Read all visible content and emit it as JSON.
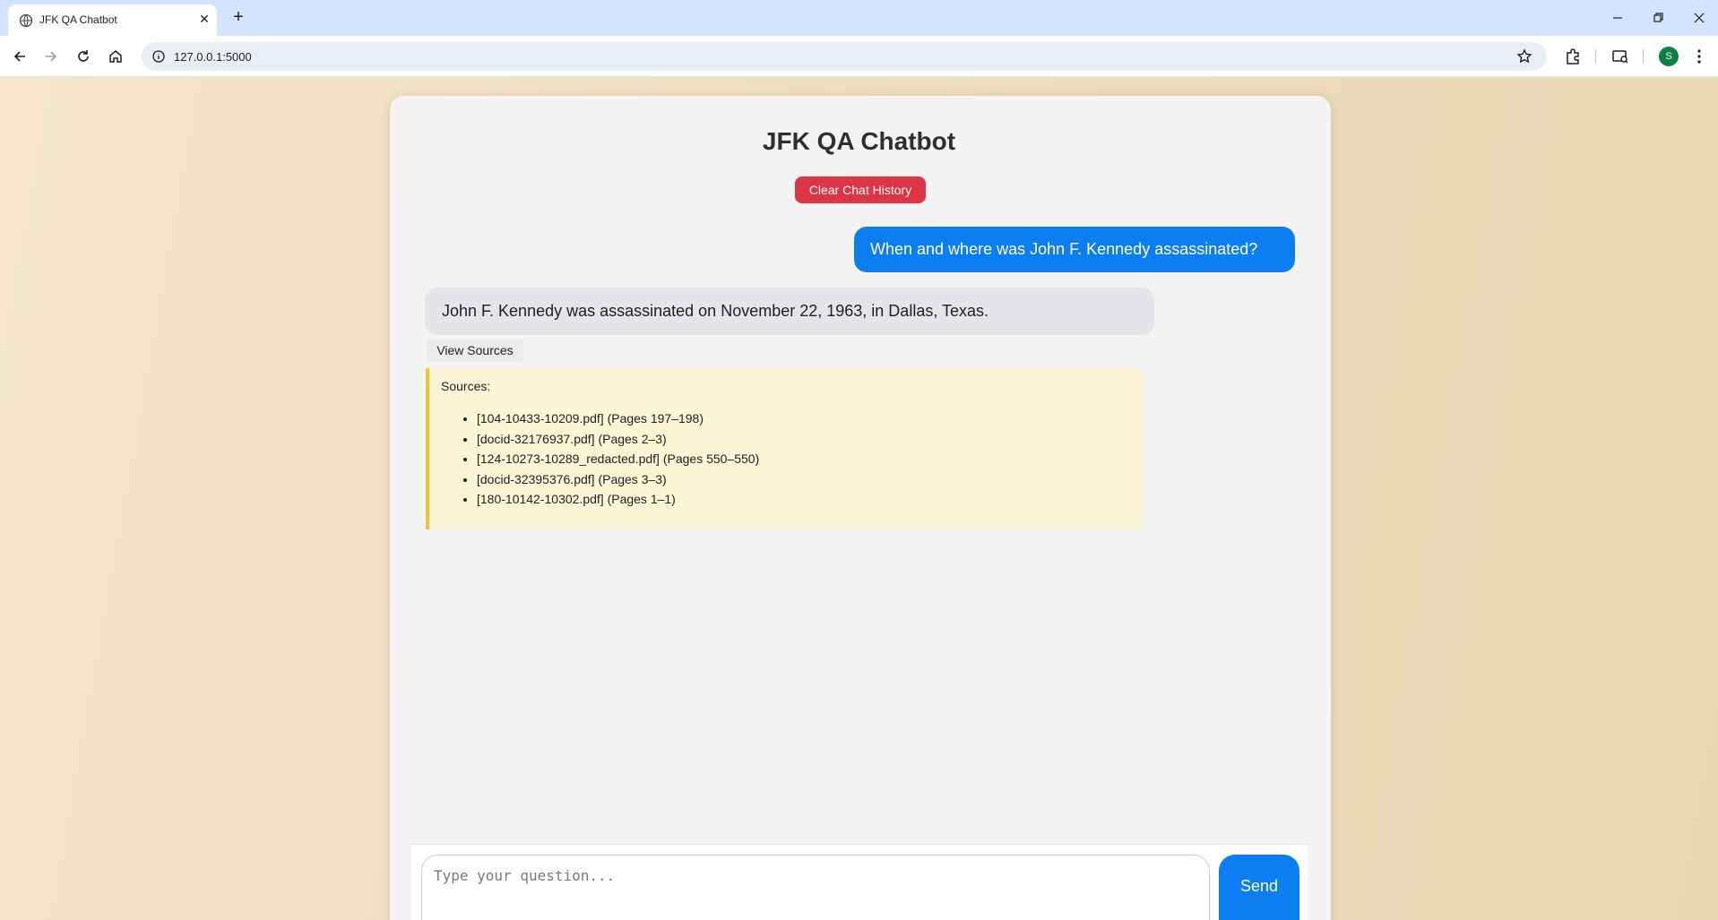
{
  "browser": {
    "tab_title": "JFK QA Chatbot",
    "tab_close": "✕",
    "new_tab": "+",
    "url": "127.0.0.1:5000",
    "profile_initial": "S",
    "icons": [
      "globe-icon",
      "back-icon",
      "forward-icon",
      "reload-icon",
      "home-icon",
      "site-info-icon",
      "star-icon",
      "extensions-icon",
      "media-icon",
      "menu-icon",
      "minimize-icon",
      "restore-icon",
      "close-window-icon"
    ]
  },
  "app": {
    "title": "JFK QA Chatbot",
    "clear_button": "Clear Chat History",
    "colors": {
      "user_bubble": "#0d7ef2",
      "bot_bubble": "#e4e5ea",
      "clear_button": "#dc3545",
      "sources_bg": "#fdf6d6",
      "sources_border": "#f5c12e"
    }
  },
  "chat": {
    "user_message": "When and where was John F. Kennedy assassinated?",
    "bot_message": "John F. Kennedy was assassinated on November 22, 1963, in Dallas, Texas.",
    "view_sources_label": "View Sources",
    "sources_heading": "Sources:",
    "sources": [
      "[104-10433-10209.pdf] (Pages 197–198)",
      "[docid-32176937.pdf] (Pages 2–3)",
      "[124-10273-10289_redacted.pdf] (Pages 550–550)",
      "[docid-32395376.pdf] (Pages 3–3)",
      "[180-10142-10302.pdf] (Pages 1–1)"
    ]
  },
  "input": {
    "placeholder": "Type your question...",
    "value": "",
    "send_label": "Send"
  }
}
